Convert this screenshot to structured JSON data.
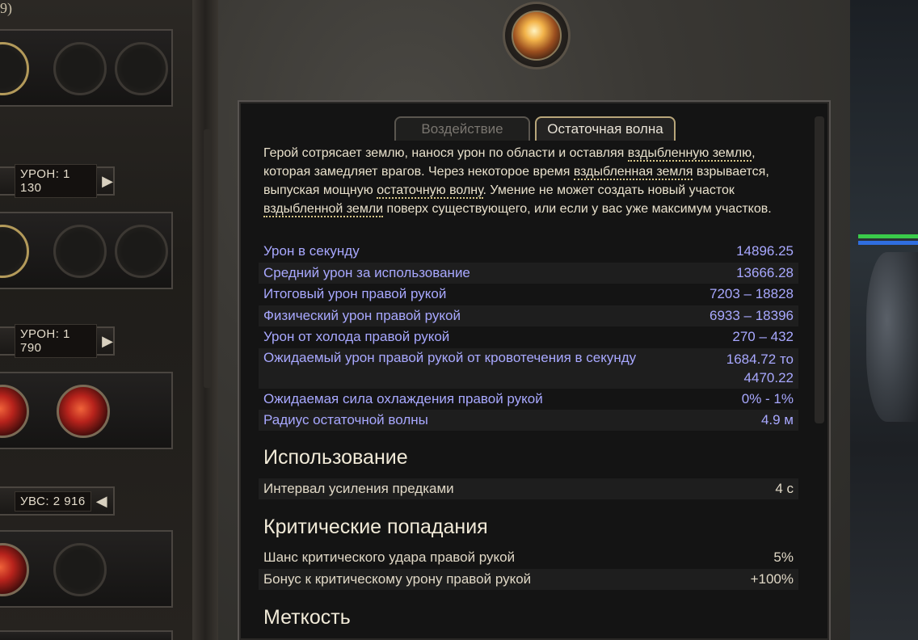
{
  "left_panel": {
    "top_caption": "9)",
    "damage_bars": [
      {
        "label": "УРОН: 1 130",
        "arrow": "▶"
      },
      {
        "label": "УРОН: 1 790",
        "arrow": "▶"
      },
      {
        "label": "УВС: 2 916",
        "arrow": "◀"
      }
    ]
  },
  "tabs": [
    {
      "label": "Воздействие",
      "active": false
    },
    {
      "label": "Остаточная волна",
      "active": true
    }
  ],
  "description": {
    "p1": "Герой сотрясает землю, нанося урон по области и оставляя ",
    "k1": "вздыбленную землю",
    "p2": ", которая замедляет врагов. Через некоторое время ",
    "k2": "вздыбленная земля",
    "p3": " взрывается, выпуская мощную ",
    "k3": "остаточную волну",
    "p4": ". Умение не может создать новый участок ",
    "k4": "вздыбленной земли",
    "p5": " поверх существующего, или если у вас уже максимум участков."
  },
  "stats": [
    {
      "label": "Урон в секунду",
      "value": "14896.25"
    },
    {
      "label": "Средний урон за использование",
      "value": "13666.28"
    },
    {
      "label": "Итоговый урон правой рукой",
      "value": "7203 – 18828"
    },
    {
      "label": "Физический урон правой рукой",
      "value": "6933 – 18396"
    },
    {
      "label": "Урон от холода правой рукой",
      "value": "270 – 432"
    },
    {
      "label": "Ожидаемый урон правой рукой от кровотечения в секунду",
      "value": "1684.72 то",
      "value2": "4470.22"
    },
    {
      "label": "Ожидаемая сила охлаждения правой рукой",
      "value": "0% - 1%"
    },
    {
      "label": "Радиус остаточной волны",
      "value": "4.9 м"
    }
  ],
  "sections": {
    "usage": {
      "title": "Использование",
      "rows": [
        {
          "label": "Интервал усиления предками",
          "value": "4 с"
        }
      ]
    },
    "crit": {
      "title": "Критические попадания",
      "rows": [
        {
          "label": "Шанс критического удара правой рукой",
          "value": "5%"
        },
        {
          "label": "Бонус к критическому урону правой рукой",
          "value": "+100%"
        }
      ]
    },
    "accuracy": {
      "title": "Меткость"
    }
  },
  "colors": {
    "stat_text": "#a8a8ff",
    "keyword_underline": "#d9c88a",
    "tab_active_border": "#b8a67a"
  }
}
